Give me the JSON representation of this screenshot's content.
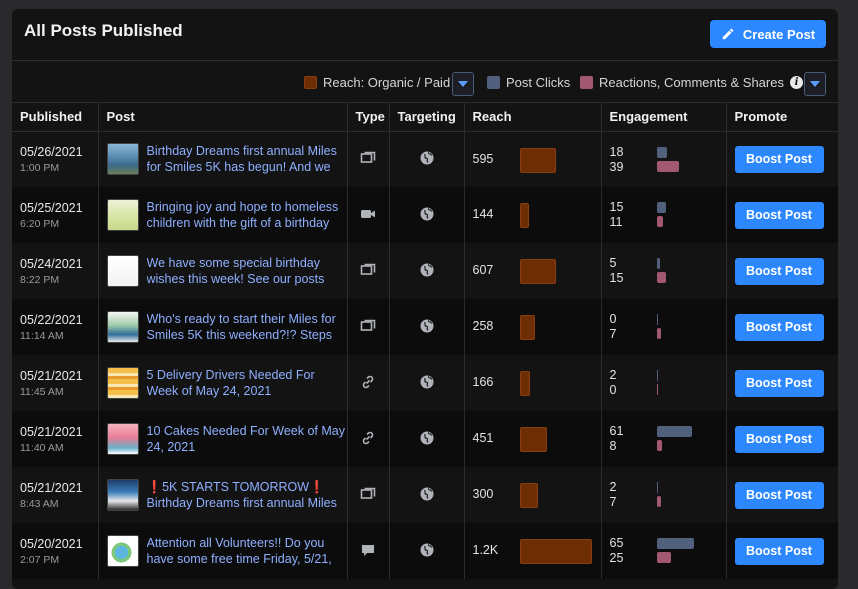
{
  "header": {
    "title": "All Posts Published",
    "create_label": "Create Post"
  },
  "legend": {
    "reach": "Reach: Organic / Paid",
    "clicks": "Post Clicks",
    "reactions": "Reactions, Comments & Shares",
    "info_glyph": "i",
    "colors": {
      "reach": "#6e2e05",
      "clicks": "#51607d",
      "reactions": "#a35872"
    }
  },
  "columns": [
    "Published",
    "Post",
    "Type",
    "Targeting",
    "Reach",
    "Engagement",
    "Promote"
  ],
  "boost_label": "Boost Post",
  "reach_max": 1200,
  "eng_max": 65,
  "rows": [
    {
      "date": "05/26/2021",
      "time": "1:00 PM",
      "text": "Birthday Dreams first annual Miles for Smiles 5K has begun! And we",
      "type": "album-icon",
      "reach": "595",
      "reach_value": 595,
      "clicks": "18",
      "reactions": "39",
      "clicks_value": 18,
      "reactions_value": 39,
      "thumb": "photo-5k"
    },
    {
      "date": "05/25/2021",
      "time": "6:20 PM",
      "text": "Bringing joy and hope to homeless children with the gift of a birthday",
      "type": "video-icon",
      "reach": "144",
      "reach_value": 144,
      "clicks": "15",
      "reactions": "11",
      "clicks_value": 15,
      "reactions_value": 11,
      "thumb": "video-card"
    },
    {
      "date": "05/24/2021",
      "time": "8:22 PM",
      "text": "We have some special birthday wishes this week! See our posts",
      "type": "album-icon",
      "reach": "607",
      "reach_value": 607,
      "clicks": "5",
      "reactions": "15",
      "clicks_value": 5,
      "reactions_value": 15,
      "thumb": "letter"
    },
    {
      "date": "05/22/2021",
      "time": "11:14 AM",
      "text": "Who's ready to start their Miles for Smiles 5K this weekend?!? Steps",
      "type": "album-icon",
      "reach": "258",
      "reach_value": 258,
      "clicks": "0",
      "reactions": "7",
      "clicks_value": 0,
      "reactions_value": 7,
      "thumb": "flyer"
    },
    {
      "date": "05/21/2021",
      "time": "11:45 AM",
      "text": "5 Delivery Drivers Needed For Week of May 24, 2021",
      "type": "link-icon",
      "reach": "166",
      "reach_value": 166,
      "clicks": "2",
      "reactions": "0",
      "clicks_value": 2,
      "reactions_value": 0,
      "thumb": "cake-yellow"
    },
    {
      "date": "05/21/2021",
      "time": "11:40 AM",
      "text": "10 Cakes Needed For Week of May 24, 2021",
      "type": "link-icon",
      "reach": "451",
      "reach_value": 451,
      "clicks": "61",
      "reactions": "8",
      "clicks_value": 61,
      "reactions_value": 8,
      "thumb": "cake-pink"
    },
    {
      "date": "05/21/2021",
      "time": "8:43 AM",
      "text": "❗5K STARTS TOMORROW❗ Birthday Dreams first annual Miles",
      "type": "album-icon",
      "reach": "300",
      "reach_value": 300,
      "clicks": "2",
      "reactions": "7",
      "clicks_value": 2,
      "reactions_value": 7,
      "thumb": "poster"
    },
    {
      "date": "05/20/2021",
      "time": "2:07 PM",
      "text": "Attention all Volunteers!! Do you have some free time Friday, 5/21,",
      "type": "status-icon",
      "reach": "1.2K",
      "reach_value": 1200,
      "clicks": "65",
      "reactions": "25",
      "clicks_value": 65,
      "reactions_value": 25,
      "thumb": "logo"
    }
  ]
}
